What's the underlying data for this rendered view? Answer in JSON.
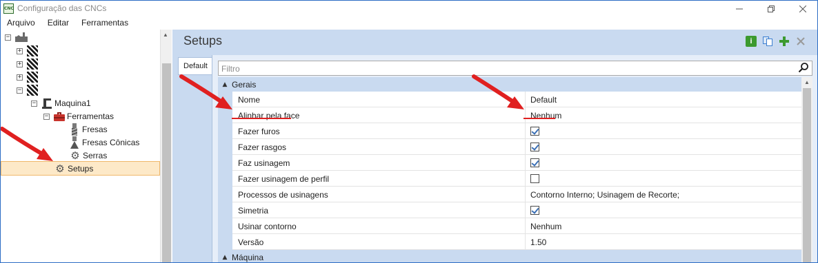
{
  "window": {
    "title": "Configuração das CNCs",
    "app_icon_label": "CNC"
  },
  "menu": [
    "Arquivo",
    "Editar",
    "Ferramentas"
  ],
  "tree": {
    "machine": "Maquina1",
    "tools": "Ferramentas",
    "mills": "Fresas",
    "conical_mills": "Fresas Cônicas",
    "saws": "Serras",
    "setups": "Setups",
    "selected": "Setups"
  },
  "panel": {
    "title": "Setups",
    "tab": "Default",
    "filter_placeholder": "Filtro"
  },
  "sections": {
    "general": "Gerais",
    "machine": "Máquina"
  },
  "properties": [
    {
      "name": "Nome",
      "value": "Default",
      "type": "text"
    },
    {
      "name": "Alinhar pela face",
      "value": "Nenhum",
      "type": "text"
    },
    {
      "name": "Fazer furos",
      "value": true,
      "type": "checkbox"
    },
    {
      "name": "Fazer rasgos",
      "value": true,
      "type": "checkbox"
    },
    {
      "name": "Faz usinagem",
      "value": true,
      "type": "checkbox"
    },
    {
      "name": "Fazer usinagem de perfil",
      "value": false,
      "type": "checkbox"
    },
    {
      "name": "Processos de usinagens",
      "value": "Contorno Interno; Usinagem de Recorte;",
      "type": "text"
    },
    {
      "name": "Simetria",
      "value": true,
      "type": "checkbox"
    },
    {
      "name": "Usinar contorno",
      "value": "Nenhum",
      "type": "text"
    },
    {
      "name": "Versão",
      "value": "1.50",
      "type": "text"
    }
  ],
  "colors": {
    "accent_blue": "#c9daf0",
    "selection": "#fde9c8",
    "annotation_red": "#e02020"
  },
  "icons": {
    "window": [
      "minimize-icon",
      "maximize-icon",
      "close-icon"
    ],
    "header": [
      "info-icon",
      "copy-icon",
      "add-icon",
      "delete-icon"
    ]
  }
}
